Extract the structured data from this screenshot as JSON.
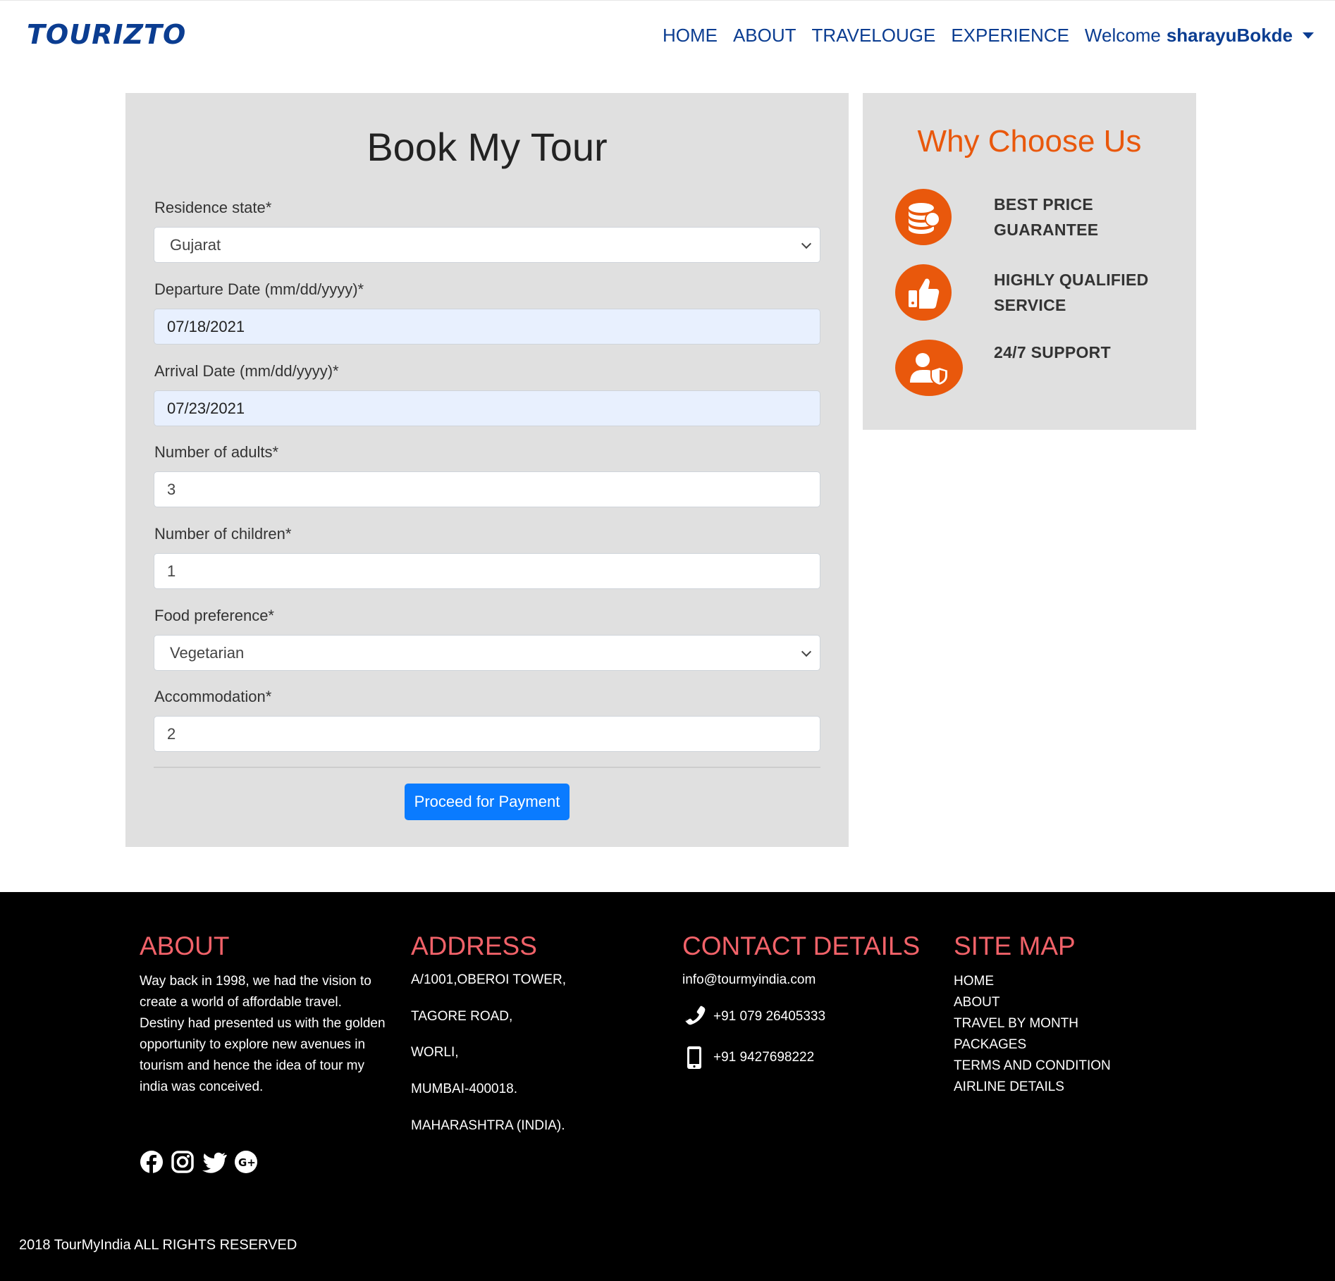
{
  "navbar": {
    "brand": "TOURIZTO",
    "links": [
      "HOME",
      "ABOUT",
      "TRAVELOUGE",
      "EXPERIENCE"
    ],
    "welcome_prefix": "Welcome",
    "username": "sharayuBokde"
  },
  "booking": {
    "title": "Book My Tour",
    "fields": [
      {
        "label": "Residence state*",
        "value": "Gujarat"
      },
      {
        "label": "Departure Date (mm/dd/yyyy)*",
        "value": "07/18/2021"
      },
      {
        "label": "Arrival Date (mm/dd/yyyy)*",
        "value": "07/23/2021"
      },
      {
        "label": "Number of adults*",
        "value": "3"
      },
      {
        "label": "Number of children*",
        "value": "1"
      },
      {
        "label": "Food preference*",
        "value": "Vegetarian"
      },
      {
        "label": "Accommodation*",
        "value": "2"
      }
    ],
    "submit_label": "Proceed for Payment"
  },
  "why": {
    "title": "Why Choose Us",
    "items": [
      {
        "line1": "BEST PRICE",
        "line2": "GUARANTEE",
        "icon": "coins-icon"
      },
      {
        "line1": "HIGHLY QUALIFIED",
        "line2": "SERVICE",
        "icon": "thumbs-up-icon"
      },
      {
        "line1": "24/7 SUPPORT",
        "line2": "",
        "icon": "user-shield-icon"
      }
    ]
  },
  "footer": {
    "about_heading": "ABOUT",
    "about_text": "Way back in 1998, we had the vision to create a world of affordable travel. Destiny had presented us with the golden opportunity to explore new avenues in tourism and hence the idea of tour my india was conceived.",
    "address_heading": "ADDRESS",
    "address_lines": [
      "A/1001,OBEROI TOWER,",
      "TAGORE ROAD,",
      "WORLI,",
      "MUMBAI-400018.",
      "MAHARASHTRA (INDIA)."
    ],
    "contact_heading": "CONTACT DETAILS",
    "email": "info@tourmyindia.com",
    "phone": "+91 079 26405333",
    "mobile": "+91 9427698222",
    "sitemap_heading": "SITE MAP",
    "sitemap_links": [
      "HOME",
      "ABOUT",
      "TRAVEL BY MONTH",
      "PACKAGES",
      "TERMS AND CONDITION",
      "AIRLINE DETAILS"
    ],
    "socials": [
      "facebook-icon",
      "instagram-icon",
      "twitter-icon",
      "google-plus-icon"
    ],
    "copyright": "2018 TourMyIndia ALL RIGHTS RESERVED"
  },
  "colors": {
    "brand": "#0b3d91",
    "accent_orange": "#e9580c",
    "footer_heading": "#f16269",
    "button": "#0a7bff",
    "panel_bg": "#e0e0e0"
  }
}
